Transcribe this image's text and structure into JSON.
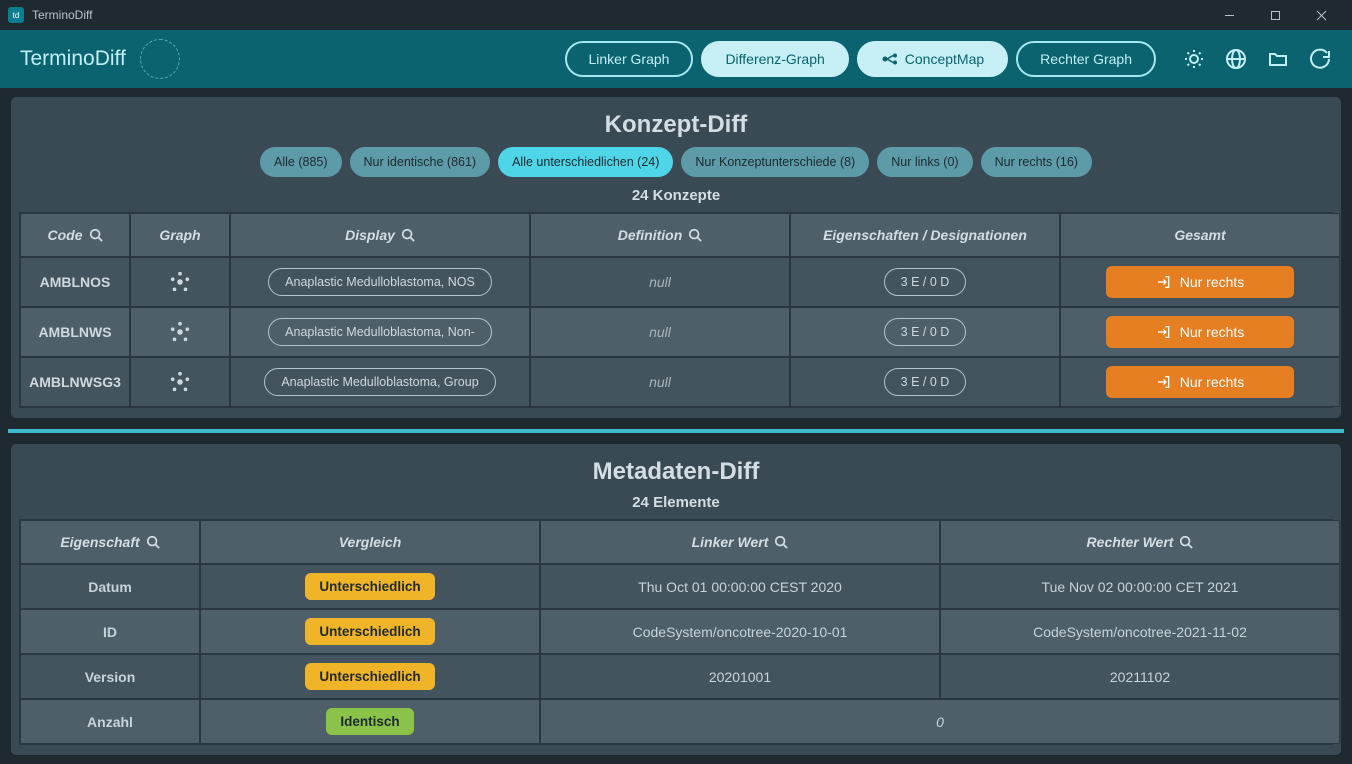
{
  "titlebar": {
    "app_name": "TerminoDiff"
  },
  "header": {
    "brand": "TerminoDiff",
    "buttons": {
      "left_graph": "Linker Graph",
      "diff_graph": "Differenz-Graph",
      "concept_map": "ConceptMap",
      "right_graph": "Rechter Graph"
    }
  },
  "konzept": {
    "title": "Konzept-Diff",
    "filters": [
      {
        "label": "Alle (885)",
        "active": false
      },
      {
        "label": "Nur identische (861)",
        "active": false
      },
      {
        "label": "Alle unterschiedlichen (24)",
        "active": true
      },
      {
        "label": "Nur Konzeptunterschiede (8)",
        "active": false
      },
      {
        "label": "Nur links (0)",
        "active": false
      },
      {
        "label": "Nur rechts (16)",
        "active": false
      }
    ],
    "count_label": "24 Konzepte",
    "headers": {
      "code": "Code",
      "graph": "Graph",
      "display": "Display",
      "definition": "Definition",
      "props": "Eigenschaften / Designationen",
      "total": "Gesamt"
    },
    "rows": [
      {
        "code": "AMBLNOS",
        "display": "Anaplastic Medulloblastoma, NOS",
        "definition": "null",
        "props": "3 E / 0 D",
        "total": "Nur rechts"
      },
      {
        "code": "AMBLNWS",
        "display": "Anaplastic Medulloblastoma, Non-",
        "definition": "null",
        "props": "3 E / 0 D",
        "total": "Nur rechts"
      },
      {
        "code": "AMBLNWSG3",
        "display": "Anaplastic Medulloblastoma, Group",
        "definition": "null",
        "props": "3 E / 0 D",
        "total": "Nur rechts"
      }
    ]
  },
  "meta": {
    "title": "Metadaten-Diff",
    "count_label": "24 Elemente",
    "headers": {
      "property": "Eigenschaft",
      "comparison": "Vergleich",
      "left_value": "Linker Wert",
      "right_value": "Rechter Wert"
    },
    "rows": [
      {
        "property": "Datum",
        "comparison": "Unterschiedlich",
        "comp_kind": "diff",
        "left": "Thu Oct 01 00:00:00 CEST 2020",
        "right": "Tue Nov 02 00:00:00 CET 2021"
      },
      {
        "property": "ID",
        "comparison": "Unterschiedlich",
        "comp_kind": "diff",
        "left": "CodeSystem/oncotree-2020-10-01",
        "right": "CodeSystem/oncotree-2021-11-02"
      },
      {
        "property": "Version",
        "comparison": "Unterschiedlich",
        "comp_kind": "diff",
        "left": "20201001",
        "right": "20211102"
      },
      {
        "property": "Anzahl",
        "comparison": "Identisch",
        "comp_kind": "same",
        "merged": "0"
      }
    ]
  }
}
